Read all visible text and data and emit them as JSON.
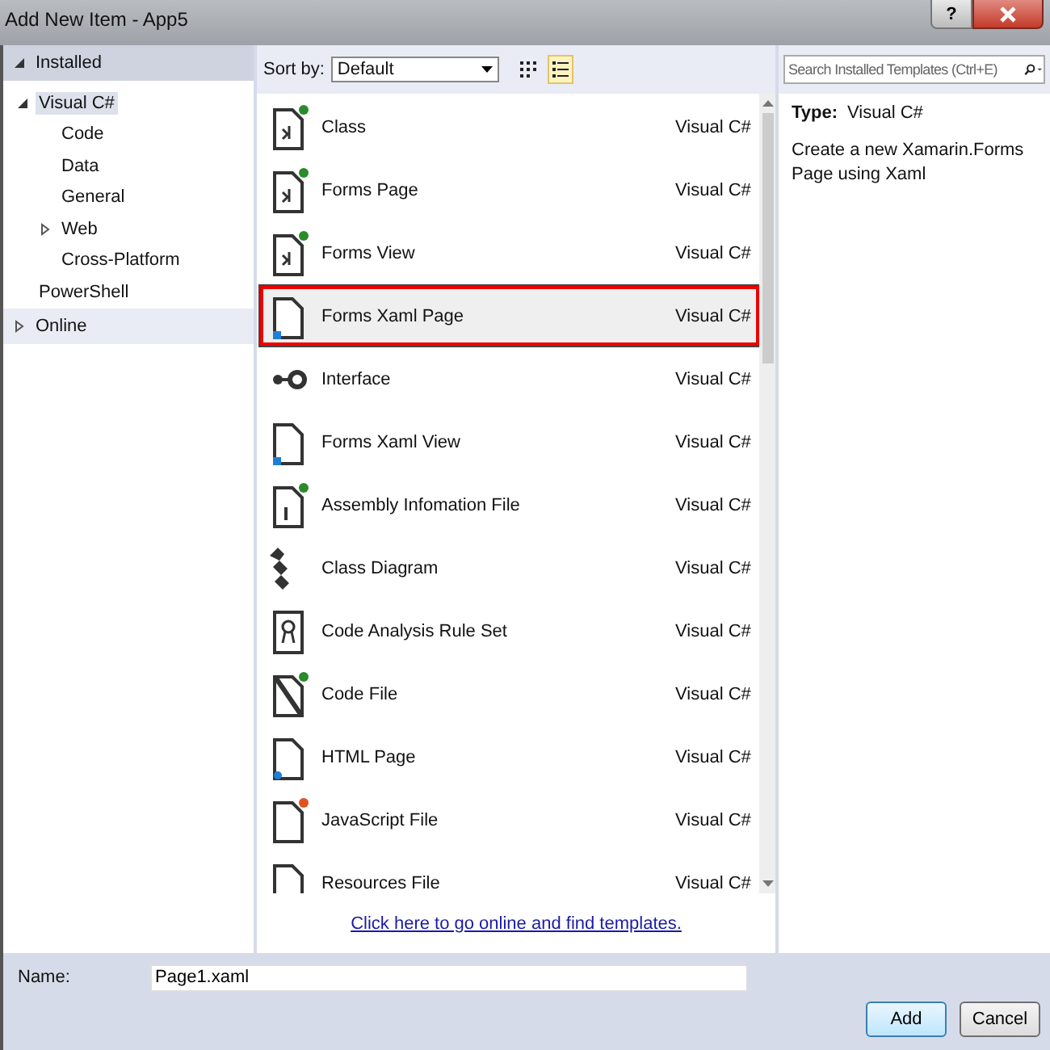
{
  "window": {
    "title": "Add New Item - App5",
    "help": "?"
  },
  "tree": [
    {
      "label": "Installed",
      "expanded": true,
      "selected": false,
      "children": [
        {
          "label": "Visual C#",
          "expanded": true,
          "selected": true,
          "children": [
            {
              "label": "Code",
              "selected": false
            },
            {
              "label": "Data",
              "selected": false
            },
            {
              "label": "General",
              "selected": false
            },
            {
              "label": "Web",
              "expanded": false,
              "selected": false
            },
            {
              "label": "Cross-Platform",
              "selected": false
            }
          ]
        },
        {
          "label": "PowerShell",
          "selected": false
        }
      ]
    },
    {
      "label": "Online",
      "expanded": false,
      "selected": false
    }
  ],
  "toolbar": {
    "sort_label": "Sort by:",
    "sort_value": "Default",
    "views": [
      {
        "kind": "grid",
        "selected": false
      },
      {
        "kind": "list",
        "selected": true
      }
    ],
    "search": {
      "placeholder": "Search Installed Templates (Ctrl+E)"
    }
  },
  "templates": [
    {
      "name": "Class",
      "language": "Visual C#",
      "selected": false
    },
    {
      "name": "Forms Page",
      "language": "Visual C#",
      "selected": false
    },
    {
      "name": "Forms View",
      "language": "Visual C#",
      "selected": false
    },
    {
      "name": "Forms Xaml Page",
      "language": "Visual C#",
      "selected": true
    },
    {
      "name": "Interface",
      "language": "Visual C#",
      "selected": false
    },
    {
      "name": "Forms Xaml View",
      "language": "Visual C#",
      "selected": false
    },
    {
      "name": "Assembly Infomation File",
      "language": "Visual C#",
      "selected": false
    },
    {
      "name": "Class Diagram",
      "language": "Visual C#",
      "selected": false
    },
    {
      "name": "Code Analysis Rule Set",
      "language": "Visual C#",
      "selected": false
    },
    {
      "name": "Code File",
      "language": "Visual C#",
      "selected": false
    },
    {
      "name": "HTML Page",
      "language": "Visual C#",
      "selected": false
    },
    {
      "name": "JavaScript File",
      "language": "Visual C#",
      "selected": false
    },
    {
      "name": "Resources File",
      "language": "Visual C#",
      "selected": false
    }
  ],
  "online_link": "Click here to go online and find templates.",
  "details": {
    "type_label": "Type:",
    "type_value": "Visual C#",
    "description": "Create a new Xamarin.Forms Page using Xaml"
  },
  "name_field": {
    "label": "Name:",
    "value": "Page1.xaml"
  },
  "buttons": [
    "Add",
    "Cancel"
  ]
}
